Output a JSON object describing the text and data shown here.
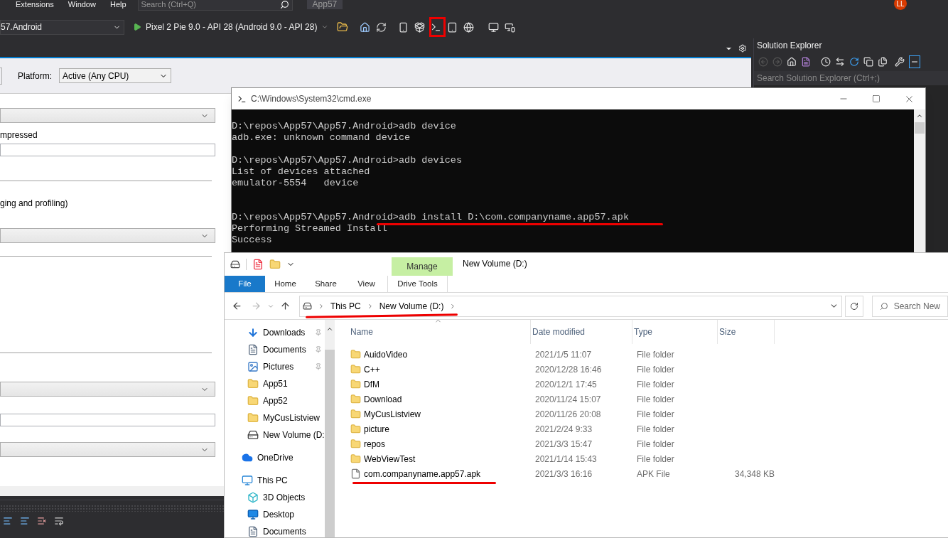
{
  "vs": {
    "menu": [
      "Extensions",
      "Window",
      "Help"
    ],
    "search": {
      "placeholder": "Search (Ctrl+Q)"
    },
    "title": "App57",
    "avatar": "LL",
    "project_dropdown": "57.Android",
    "run_target": "Pixel 2 Pie 9.0 - API 28 (Android 9.0 - API 28)",
    "platform": {
      "label": "Platform:",
      "value": "Active (Any CPU)"
    },
    "form": [
      {
        "kind": "select"
      },
      {
        "kind": "label",
        "text": "mpressed"
      },
      {
        "kind": "input"
      },
      {
        "kind": "rule"
      },
      {
        "kind": "label",
        "text": "ging and profiling)"
      },
      {
        "kind": "select"
      },
      {
        "kind": "rule"
      },
      {
        "kind": "rule"
      },
      {
        "kind": "select"
      },
      {
        "kind": "input"
      },
      {
        "kind": "select"
      }
    ],
    "solution_explorer": {
      "title": "Solution Explorer",
      "search_placeholder": "Search Solution Explorer (Ctrl+;)"
    }
  },
  "cmd": {
    "title": "C:\\Windows\\System32\\cmd.exe",
    "blocks": [
      {
        "kind": "normal",
        "lines": [
          "D:\\repos\\App57\\App57.Android>adb device",
          "adb.exe: unknown command device"
        ]
      },
      {
        "kind": "normal",
        "lines": [
          "D:\\repos\\App57\\App57.Android>adb devices",
          "List of devices attached",
          "emulator-5554   device"
        ]
      },
      {
        "kind": "wide",
        "lines": [
          "D:\\repos\\App57\\App57.Android>adb install D:\\com.companyname.app57.apk",
          "Performing Streamed Install",
          "Success"
        ]
      }
    ]
  },
  "explorer": {
    "title": "New Volume (D:)",
    "context_tab": "Manage",
    "context_subtab": "Drive Tools",
    "tabs": [
      {
        "label": "File",
        "selected": true
      },
      {
        "label": "Home",
        "selected": false
      },
      {
        "label": "Share",
        "selected": false
      },
      {
        "label": "View",
        "selected": false
      }
    ],
    "breadcrumb": [
      "This PC",
      "New Volume (D:)"
    ],
    "search": {
      "placeholder": "Search New"
    },
    "nav": [
      {
        "kind": "download",
        "label": "Downloads",
        "pinned": true
      },
      {
        "kind": "document",
        "label": "Documents",
        "pinned": true
      },
      {
        "kind": "picture",
        "label": "Pictures",
        "pinned": true
      },
      {
        "kind": "folder",
        "label": "App51",
        "pinned": false
      },
      {
        "kind": "folder",
        "label": "App52",
        "pinned": false
      },
      {
        "kind": "folder",
        "label": "MyCusListview",
        "pinned": false
      },
      {
        "kind": "drive",
        "label": "New Volume (D:",
        "pinned": false
      },
      {
        "kind": "cloud",
        "label": "OneDrive",
        "pinned": false
      },
      {
        "kind": "pc",
        "label": "This PC",
        "pinned": false
      },
      {
        "kind": "cube",
        "label": "3D Objects",
        "pinned": false
      },
      {
        "kind": "desktop",
        "label": "Desktop",
        "pinned": false
      },
      {
        "kind": "document",
        "label": "Documents",
        "pinned": false
      }
    ],
    "columns": [
      "Name",
      "Date modified",
      "Type",
      "Size"
    ],
    "rows": [
      {
        "kind": "folder",
        "name": "AuidoVideo",
        "date": "2021/1/5 11:07",
        "type": "File folder"
      },
      {
        "kind": "folder",
        "name": "C++",
        "date": "2020/12/28 16:46",
        "type": "File folder"
      },
      {
        "kind": "folder",
        "name": "DfM",
        "date": "2020/12/1 17:45",
        "type": "File folder"
      },
      {
        "kind": "folder",
        "name": "Download",
        "date": "2020/11/24 15:07",
        "type": "File folder"
      },
      {
        "kind": "folder",
        "name": "MyCusListview",
        "date": "2020/11/26 20:08",
        "type": "File folder"
      },
      {
        "kind": "folder",
        "name": "picture",
        "date": "2021/2/24 9:33",
        "type": "File folder"
      },
      {
        "kind": "folder",
        "name": "repos",
        "date": "2021/3/3 15:47",
        "type": "File folder"
      },
      {
        "kind": "folder",
        "name": "WebViewTest",
        "date": "2021/1/14 15:43",
        "type": "File folder"
      },
      {
        "kind": "file",
        "name": "com.companyname.app57.apk",
        "date": "2021/3/3 16:16",
        "type": "APK File",
        "size": "34,348 KB"
      }
    ]
  }
}
